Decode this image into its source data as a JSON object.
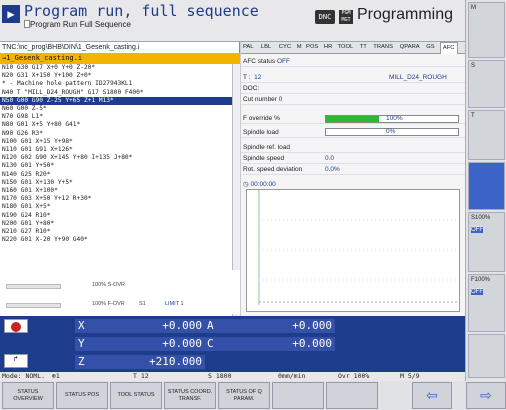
{
  "header": {
    "mode_icon": "program-run-icon",
    "title": "Program run, full sequence",
    "subtitle": "Program Run Full Sequence",
    "dnc": "DNC",
    "pgm": "PGM MGT",
    "programming": "Programming"
  },
  "program": {
    "path": "TNC:\\nc_prog\\BHB\\DIN\\1_Gesenk_casting.i",
    "name": "→1_Gesenk_casting.i",
    "lines": [
      "N10 G30 G17 X+0 Y+0 Z-20*",
      "N20 G31 X+150 Y+100 Z+0*",
      "* - Machine hole pattern ID27943KL1",
      "N40 T \"MILL_D24_ROUGH\" G17 S1800 F400*",
      "N50 G00 G90 Z-25 Y+65 Z+1 M13*",
      "N60 G00 Z-5*",
      "N70 G98 L1*",
      "N80 G01 X+5 Y+80 G41*",
      "N90 G26 R3*",
      "N100 G01 X+15 Y+98*",
      "N110 G01 G91 X+126*",
      "N120 G02 G90 X+145 Y+80 I+135 J+80*",
      "N130 G01 Y+50*",
      "N140 G25 R20*",
      "N150 G01 X+130 Y+5*",
      "N160 G01 X+100*",
      "N170 G03 X+50 Y+12 R+30*",
      "N180 G01 X+5*",
      "N190 G24 R10*",
      "N200 G01 Y+80*",
      "N210 G27 R10*",
      "N220 G01 X-20 Y+90 G40*"
    ],
    "selected": 4,
    "override_s": "100% S-OVR",
    "override_f": "100% F-OVR",
    "s1": "S1",
    "limit": "LIMIT 1"
  },
  "tabs": [
    "PAL",
    "LBL",
    "CYC",
    "M",
    "POS",
    "HR",
    "TOOL",
    "TT",
    "TRANS",
    "QPARA",
    "GS",
    "AFC"
  ],
  "active_tab": "AFC",
  "afc": {
    "status_label": "AFC status",
    "status_value": "OFF",
    "t_label": "T :",
    "t_num": "12",
    "tool": "MILL_D24_ROUGH",
    "doc_label": "DOC:",
    "cut_label": "Cut number",
    "cut_value": "0",
    "fov_label": "F override %",
    "fov_value": "100%",
    "fov_fraction": 1.0,
    "sl_label": "Spindle load",
    "sl_value": "0%",
    "sref_label": "Spindle ref. load",
    "ss_label": "Spindle speed",
    "ss_value": "0.0",
    "rsd_label": "Rot. speed deviation",
    "rsd_value": "0.0%",
    "time": "00:00:00"
  },
  "axes": [
    {
      "name": "X",
      "value": "+0.000",
      "name2": "A",
      "value2": "+0.000"
    },
    {
      "name": "Y",
      "value": "+0.000",
      "name2": "C",
      "value2": "+0.000"
    },
    {
      "name": "Z",
      "value": "+210.000"
    }
  ],
  "status": {
    "mode": "Mode: NOML.",
    "tool": "T 12",
    "spindle": "S 1800",
    "feed": "0mm/min",
    "ovr": "Ovr 100%",
    "m": "M 5/9"
  },
  "softkeys": [
    "STATUS OVERVIEW",
    "STATUS POS",
    "TOOL STATUS",
    "STATUS COORD. TRANSF.",
    "STATUS OF Q PARAM."
  ],
  "side": {
    "s100": "S100%",
    "off1": "OFF",
    "f100": "F100%",
    "off2": "OFF"
  }
}
